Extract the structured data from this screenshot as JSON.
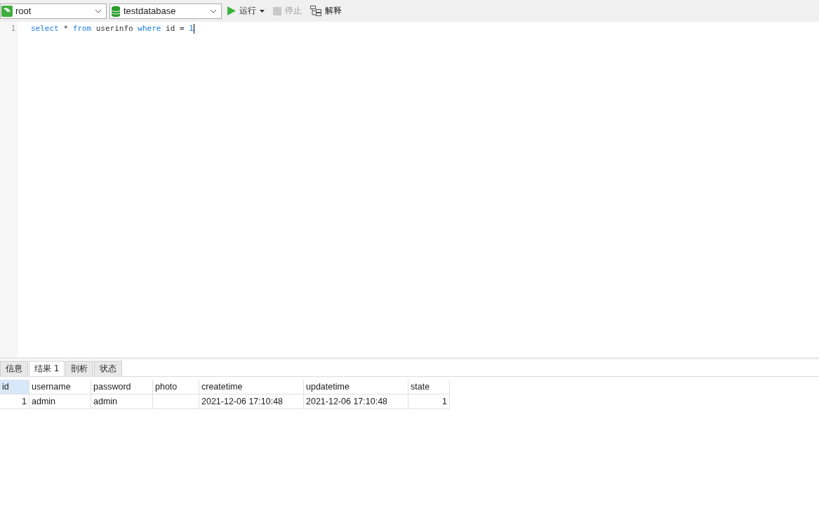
{
  "toolbar": {
    "connection": "root",
    "database": "testdatabase",
    "buttons": [
      {
        "kind": "run",
        "label": "运行",
        "disabled": false,
        "dropdown": true
      },
      {
        "kind": "stop",
        "label": "停止",
        "disabled": true,
        "dropdown": false
      },
      {
        "kind": "explain",
        "label": "解释",
        "disabled": false,
        "dropdown": false
      }
    ]
  },
  "editor": {
    "lines": [
      {
        "number": "1",
        "tokens": [
          {
            "text": "select",
            "kind": "keyword"
          },
          {
            "text": "*",
            "kind": "plain"
          },
          {
            "text": "from",
            "kind": "keyword"
          },
          {
            "text": "userinfo",
            "kind": "plain"
          },
          {
            "text": "where",
            "kind": "keyword"
          },
          {
            "text": "id",
            "kind": "plain"
          },
          {
            "text": "=",
            "kind": "plain"
          },
          {
            "text": "1",
            "kind": "number"
          }
        ]
      }
    ]
  },
  "tabs": [
    {
      "label": "信息",
      "selected": false
    },
    {
      "label": "结果 1",
      "selected": true
    },
    {
      "label": "剖析",
      "selected": false
    },
    {
      "label": "状态",
      "selected": false
    }
  ],
  "table": {
    "columns": [
      {
        "label": "id",
        "selected": true,
        "kind": "number"
      },
      {
        "label": "username",
        "selected": false,
        "kind": "text"
      },
      {
        "label": "password",
        "selected": false,
        "kind": "text"
      },
      {
        "label": "photo",
        "selected": false,
        "kind": "text"
      },
      {
        "label": "createtime",
        "selected": false,
        "kind": "text"
      },
      {
        "label": "updatetime",
        "selected": false,
        "kind": "text"
      },
      {
        "label": "state",
        "selected": false,
        "kind": "number"
      }
    ],
    "rows": [
      [
        "1",
        "admin",
        "admin",
        "",
        "2021-12-06 17:10:48",
        "2021-12-06 17:10:48",
        "1"
      ]
    ]
  }
}
